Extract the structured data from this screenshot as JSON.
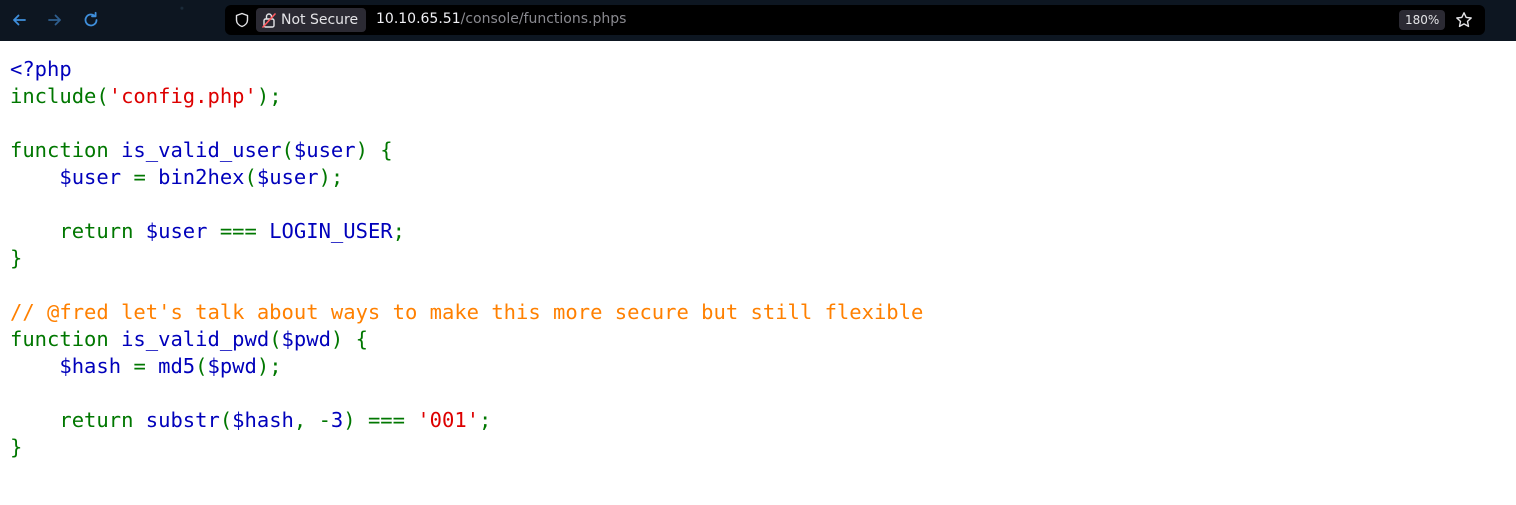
{
  "browser": {
    "security_label": "Not Secure",
    "url_host": "10.10.65.51",
    "url_path": "/console/functions.phps",
    "zoom": "180%"
  },
  "icons": {
    "back": "arrow-left-icon",
    "forward": "arrow-right-icon",
    "reload": "reload-icon",
    "shield": "shield-icon",
    "lock": "broken-lock-icon",
    "bookmark": "star-icon"
  },
  "colors": {
    "keyword": "#007700",
    "default": "#0000bb",
    "string": "#dd0000",
    "comment": "#ff8000"
  },
  "code": {
    "lines": [
      [
        {
          "t": "<?php",
          "c": "d"
        }
      ],
      [
        {
          "t": "include(",
          "c": "k"
        },
        {
          "t": "'config.php'",
          "c": "s"
        },
        {
          "t": ");",
          "c": "k"
        }
      ],
      [],
      [
        {
          "t": "function ",
          "c": "k"
        },
        {
          "t": "is_valid_user",
          "c": "d"
        },
        {
          "t": "(",
          "c": "k"
        },
        {
          "t": "$user",
          "c": "d"
        },
        {
          "t": ") {",
          "c": "k"
        }
      ],
      [
        {
          "t": "    ",
          "c": "k"
        },
        {
          "t": "$user ",
          "c": "d"
        },
        {
          "t": "= ",
          "c": "k"
        },
        {
          "t": "bin2hex",
          "c": "d"
        },
        {
          "t": "(",
          "c": "k"
        },
        {
          "t": "$user",
          "c": "d"
        },
        {
          "t": ");",
          "c": "k"
        }
      ],
      [],
      [
        {
          "t": "    return ",
          "c": "k"
        },
        {
          "t": "$user ",
          "c": "d"
        },
        {
          "t": "=== ",
          "c": "k"
        },
        {
          "t": "LOGIN_USER",
          "c": "d"
        },
        {
          "t": ";",
          "c": "k"
        }
      ],
      [
        {
          "t": "}",
          "c": "k"
        }
      ],
      [],
      [
        {
          "t": "// @fred let's talk about ways to make this more secure but still flexible",
          "c": "c"
        }
      ],
      [
        {
          "t": "function ",
          "c": "k"
        },
        {
          "t": "is_valid_pwd",
          "c": "d"
        },
        {
          "t": "(",
          "c": "k"
        },
        {
          "t": "$pwd",
          "c": "d"
        },
        {
          "t": ") {",
          "c": "k"
        }
      ],
      [
        {
          "t": "    ",
          "c": "k"
        },
        {
          "t": "$hash ",
          "c": "d"
        },
        {
          "t": "= ",
          "c": "k"
        },
        {
          "t": "md5",
          "c": "d"
        },
        {
          "t": "(",
          "c": "k"
        },
        {
          "t": "$pwd",
          "c": "d"
        },
        {
          "t": ");",
          "c": "k"
        }
      ],
      [],
      [
        {
          "t": "    return ",
          "c": "k"
        },
        {
          "t": "substr",
          "c": "d"
        },
        {
          "t": "(",
          "c": "k"
        },
        {
          "t": "$hash",
          "c": "d"
        },
        {
          "t": ", -",
          "c": "k"
        },
        {
          "t": "3",
          "c": "d"
        },
        {
          "t": ") === ",
          "c": "k"
        },
        {
          "t": "'001'",
          "c": "s"
        },
        {
          "t": ";",
          "c": "k"
        }
      ],
      [
        {
          "t": "}",
          "c": "k"
        }
      ]
    ]
  }
}
